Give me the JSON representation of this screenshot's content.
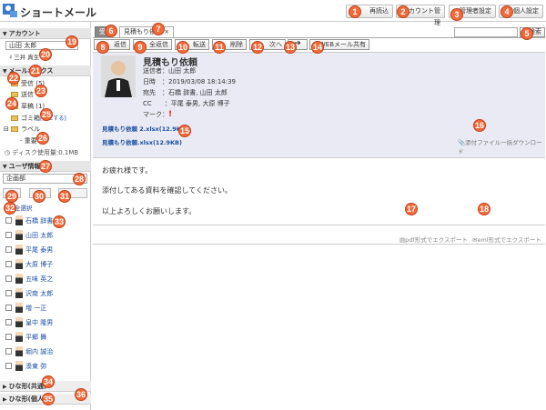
{
  "header": {
    "title": "ショートメール",
    "buttons": {
      "reread": "再読込",
      "account": "アカウント管理",
      "admin": "管理者設定",
      "personal": "個人設定"
    }
  },
  "sidebar": {
    "account_head": "アカウント",
    "account_name": "山田 太郎",
    "account_sub": "三井 真生",
    "mailbox_head": "メールボックス",
    "folders": {
      "inbox": "受信 (5)",
      "sent": "送信",
      "draft": "草稿 (1)",
      "trash": "ゴミ箱",
      "trash_empty": "[空にする]",
      "label": "ラベル",
      "important": "重要"
    },
    "disk": "ディスク使用量:0.1MB",
    "user_head": "ユーザ情報",
    "group": "企画部",
    "select_all": "全選択",
    "users": [
      "石橋 辞書",
      "山田 太郎",
      "平尾 泰男",
      "大原 博子",
      "五味 英之",
      "沢南 太郎",
      "増 一正",
      "皇中 隆男",
      "平郷 舞",
      "堀内 誠治",
      "湊東 弥"
    ],
    "template_shared": "ひな形(共通)",
    "template_personal": "ひな形(個人)"
  },
  "main": {
    "tab_main": "受",
    "tab_mail": "見積もり依頼",
    "toolbar": {
      "reply": "返信",
      "reply_all": "全返信",
      "forward": "転送",
      "delete": "削除",
      "next": "次へ",
      "share": "WEBメール共有"
    },
    "search_btn": "検索",
    "mail": {
      "subject": "見積もり依頼",
      "from": "送信者：山田 太郎",
      "date": "日時　：2019/03/08 18:14:39",
      "to": "宛先　：石橋 辞書, 山田 太郎",
      "cc": "CC　　：平尾 泰男, 大原 博子",
      "mark": "マーク：",
      "att1": "見積もり依頼 2.xlsx(12.9KB)",
      "att2": "見積もり依頼.xlsx(12.9KB)",
      "att_dl": "添付ファイル一括ダウンロード",
      "body": [
        "お疲れ様です。",
        "添付してある資料を確認してください。",
        "以上よろしくお願いします。"
      ]
    },
    "export_pdf": "pdf形式でエクスポート",
    "export_eml": "eml形式でエクスポート"
  },
  "badges": [
    "1",
    "2",
    "3",
    "4",
    "5",
    "6",
    "7",
    "8",
    "9",
    "10",
    "11",
    "12",
    "13",
    "14",
    "15",
    "16",
    "17",
    "18",
    "19",
    "20",
    "21",
    "22",
    "23",
    "24",
    "25",
    "26",
    "27",
    "28",
    "29",
    "30",
    "31",
    "32",
    "33",
    "34",
    "35",
    "36"
  ],
  "colors": {
    "badge": "#f26a3a",
    "link": "#1a4fa0"
  }
}
